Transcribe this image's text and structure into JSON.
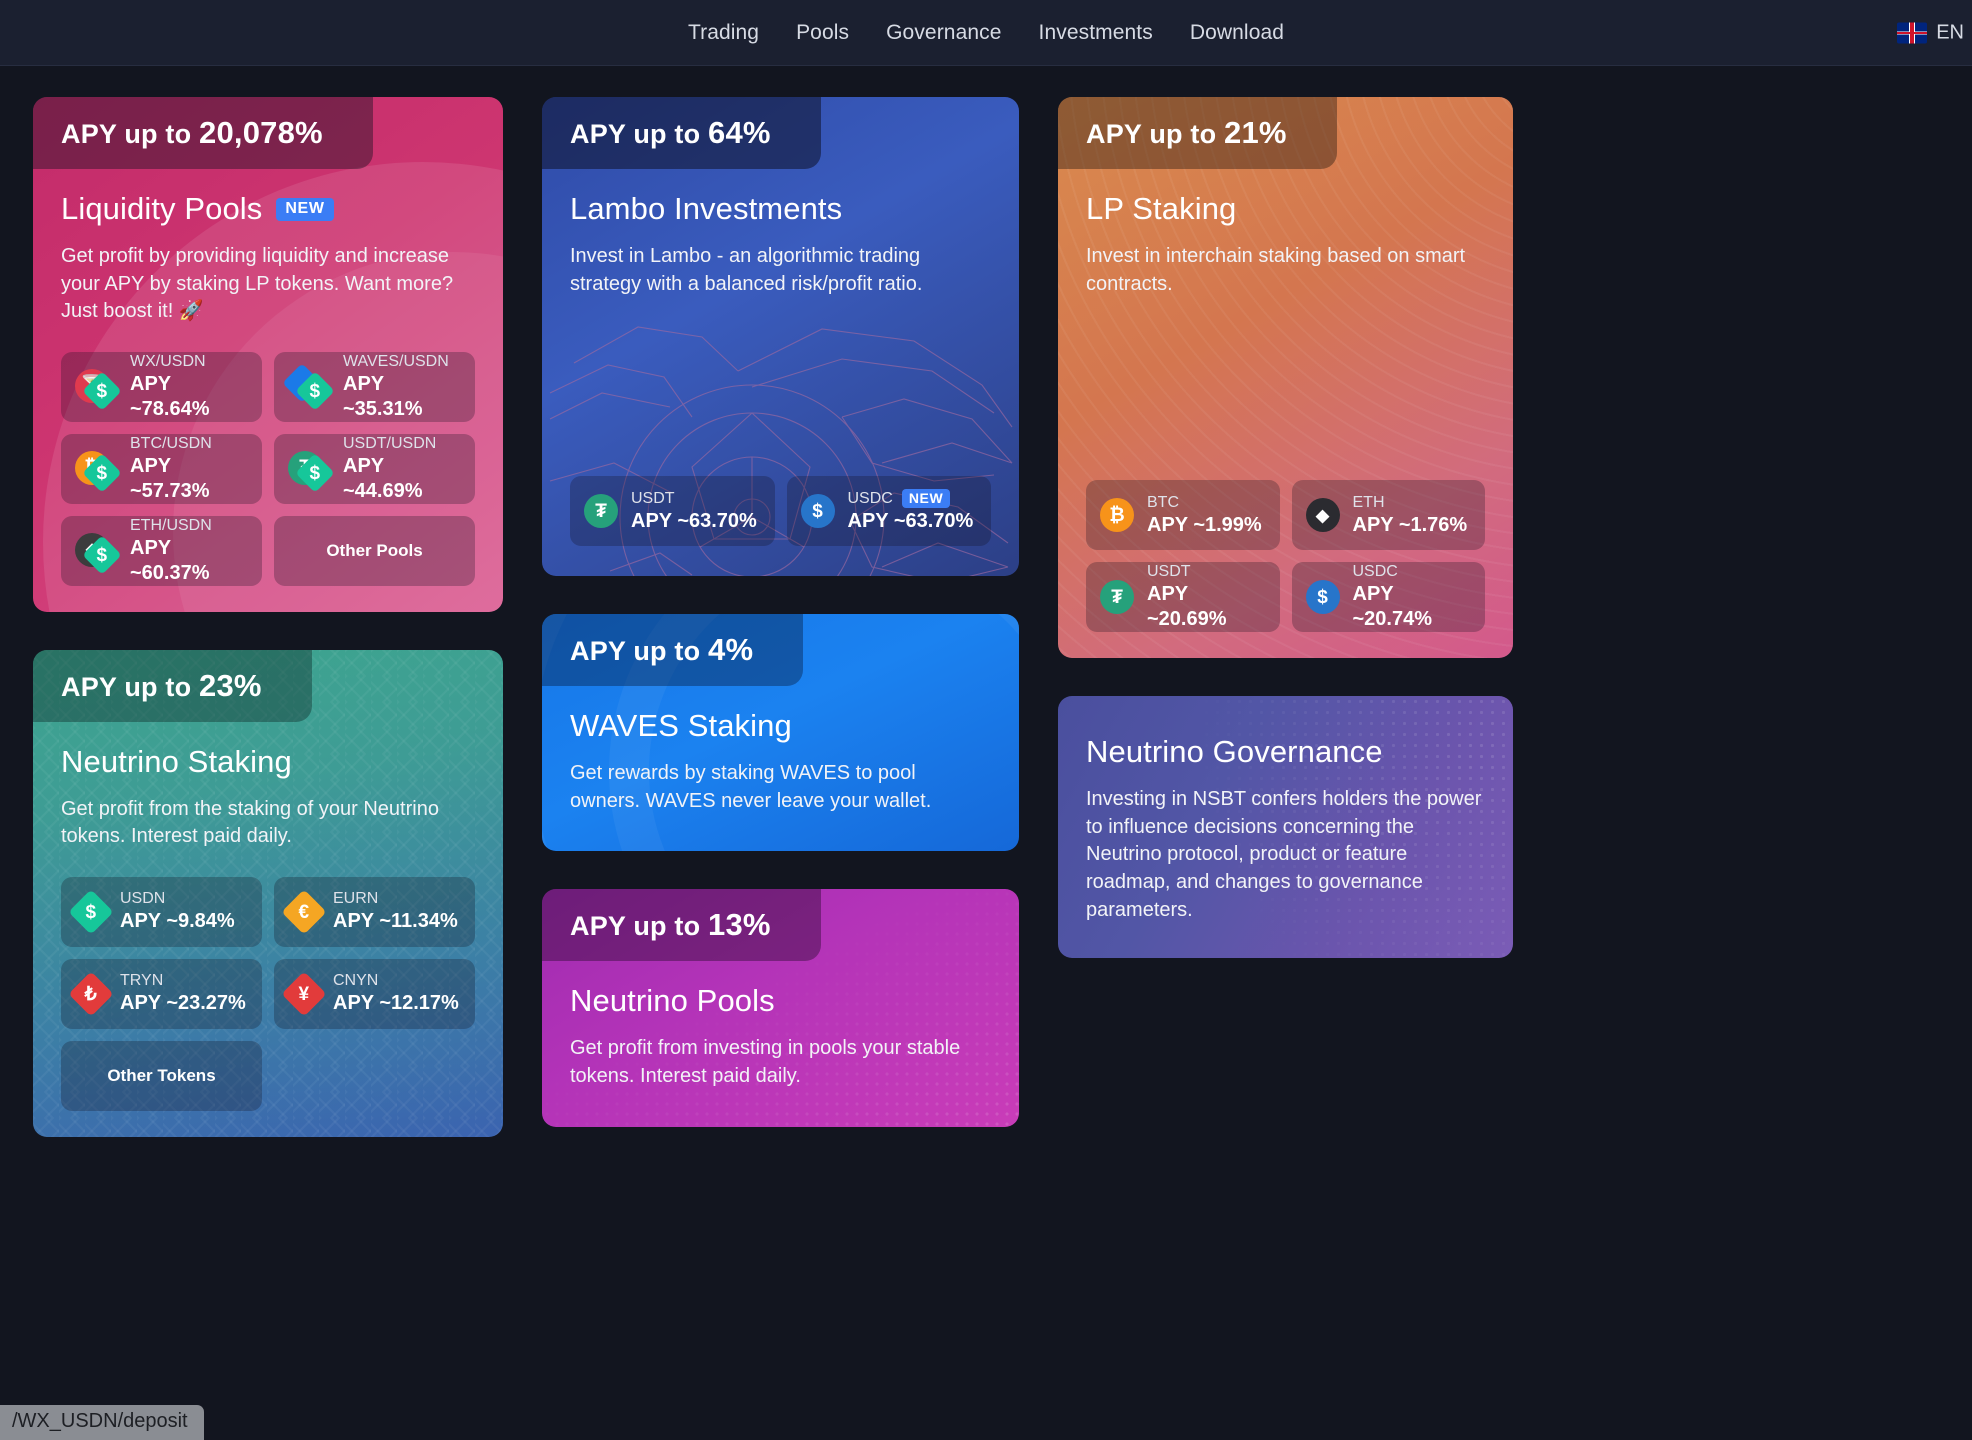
{
  "header": {
    "nav": [
      {
        "label": "Trading"
      },
      {
        "label": "Pools"
      },
      {
        "label": "Governance"
      },
      {
        "label": "Investments"
      },
      {
        "label": "Download"
      }
    ],
    "language": "EN",
    "flag_icon": "uk-flag-icon"
  },
  "colors": {
    "page_bg": "#12151f",
    "topbar_bg": "#1b2030",
    "badge_new": "#3b7df5",
    "liquidity_pools": "#cd3570",
    "lambo": "#3a5cbe",
    "lp_staking": "#d4764f",
    "neutrino_staking": "#3e9c95",
    "waves_staking": "#1b82f0",
    "governance": "#6b55ad",
    "neutrino_pools": "#b333b8"
  },
  "cards": {
    "liquidity_pools": {
      "ribbon_prefix": "APY up to ",
      "ribbon_value": "20,078%",
      "title": "Liquidity Pools",
      "badge": "NEW",
      "desc": "Get profit by providing liquidity and increase your APY by staking LP tokens. Want more? Just boost it! 🚀",
      "chips": [
        {
          "name": "WX/USDN",
          "apy": "APY ~78.64%",
          "icon_a": "wx-coin-icon",
          "icon_b": "usdn-coin-icon"
        },
        {
          "name": "WAVES/USDN",
          "apy": "APY ~35.31%",
          "icon_a": "waves-coin-icon",
          "icon_b": "usdn-coin-icon"
        },
        {
          "name": "BTC/USDN",
          "apy": "APY ~57.73%",
          "icon_a": "btc-coin-icon",
          "icon_b": "usdn-coin-icon"
        },
        {
          "name": "USDT/USDN",
          "apy": "APY ~44.69%",
          "icon_a": "usdt-coin-icon",
          "icon_b": "usdn-coin-icon"
        },
        {
          "name": "ETH/USDN",
          "apy": "APY ~60.37%",
          "icon_a": "eth-coin-icon",
          "icon_b": "usdn-coin-icon"
        }
      ],
      "other_label": "Other Pools"
    },
    "lambo": {
      "ribbon_prefix": "APY up to ",
      "ribbon_value": "64%",
      "title": "Lambo Investments",
      "desc": "Invest in Lambo - an algorithmic trading strategy with a balanced risk/profit ratio.",
      "art": "lambo-car-wireframe",
      "chips": [
        {
          "name": "USDT",
          "apy": "APY ~63.70%",
          "icon": "usdt-coin-icon",
          "badge": ""
        },
        {
          "name": "USDC",
          "apy": "APY ~63.70%",
          "icon": "usdc-coin-icon",
          "badge": "NEW"
        }
      ]
    },
    "lp_staking": {
      "ribbon_prefix": "APY up to ",
      "ribbon_value": "21%",
      "title": "LP Staking",
      "desc": "Invest in interchain staking based on smart contracts.",
      "chips": [
        {
          "name": "BTC",
          "apy": "APY ~1.99%",
          "icon": "btc-coin-icon"
        },
        {
          "name": "ETH",
          "apy": "APY ~1.76%",
          "icon": "eth-coin-icon"
        },
        {
          "name": "USDT",
          "apy": "APY ~20.69%",
          "icon": "usdt-coin-icon"
        },
        {
          "name": "USDC",
          "apy": "APY ~20.74%",
          "icon": "usdc-coin-icon"
        }
      ]
    },
    "neutrino_staking": {
      "ribbon_prefix": "APY up to ",
      "ribbon_value": "23%",
      "title": "Neutrino Staking",
      "desc": "Get profit from the staking of your Neutrino tokens. Interest paid daily.",
      "chips": [
        {
          "name": "USDN",
          "apy": "APY ~9.84%",
          "icon": "usdn-coin-icon"
        },
        {
          "name": "EURN",
          "apy": "APY ~11.34%",
          "icon": "eurn-coin-icon"
        },
        {
          "name": "TRYN",
          "apy": "APY ~23.27%",
          "icon": "tryn-coin-icon"
        },
        {
          "name": "CNYN",
          "apy": "APY ~12.17%",
          "icon": "cnyn-coin-icon"
        }
      ],
      "other_label": "Other Tokens"
    },
    "waves_staking": {
      "ribbon_prefix": "APY up to ",
      "ribbon_value": "4%",
      "title": "WAVES Staking",
      "desc": "Get rewards by staking WAVES to pool owners. WAVES never leave your wallet."
    },
    "governance": {
      "title": "Neutrino Governance",
      "desc": "Investing in NSBT confers holders the power to influence decisions concerning the Neutrino protocol, product or feature roadmap, and changes to governance parameters."
    },
    "neutrino_pools": {
      "ribbon_prefix": "APY up to ",
      "ribbon_value": "13%",
      "title": "Neutrino Pools",
      "desc": "Get profit from investing in pools your stable tokens. Interest paid daily."
    }
  },
  "status_bar": "/WX_USDN/deposit"
}
